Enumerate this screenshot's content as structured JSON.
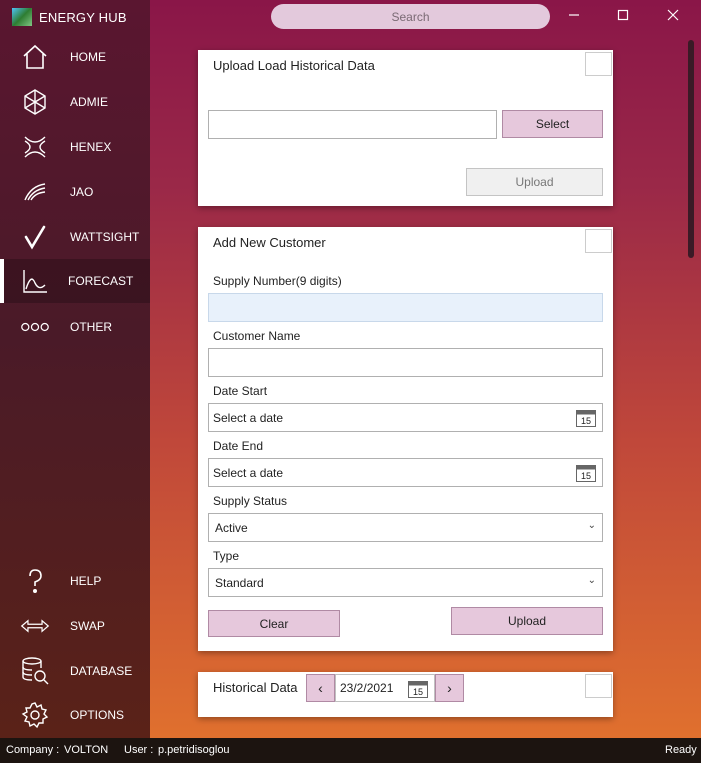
{
  "app": {
    "title": "ENERGY HUB"
  },
  "sidebar": {
    "items": [
      {
        "label": "HOME",
        "icon": "home-icon"
      },
      {
        "label": "ADMIE",
        "icon": "admie-logo-icon"
      },
      {
        "label": "HENEX",
        "icon": "henex-logo-icon"
      },
      {
        "label": "JAO",
        "icon": "jao-logo-icon"
      },
      {
        "label": "WATTSIGHT",
        "icon": "wattsight-logo-icon"
      },
      {
        "label": "FORECAST",
        "icon": "chart-icon",
        "active": true
      },
      {
        "label": "OTHER",
        "icon": "dots-icon"
      }
    ],
    "bottom_items": [
      {
        "label": "HELP",
        "icon": "question-icon"
      },
      {
        "label": "SWAP",
        "icon": "swap-arrows-icon"
      },
      {
        "label": "DATABASE",
        "icon": "database-search-icon"
      },
      {
        "label": "OPTIONS",
        "icon": "gear-icon"
      }
    ]
  },
  "search": {
    "placeholder": "Search"
  },
  "upload_historical": {
    "title": "Upload Load Historical Data",
    "file_value": "",
    "select_label": "Select",
    "upload_label": "Upload"
  },
  "add_customer": {
    "title": "Add New Customer",
    "supply_number_label": "Supply Number(9 digits)",
    "supply_number_value": "",
    "customer_name_label": "Customer Name",
    "customer_name_value": "",
    "date_start_label": "Date Start",
    "date_start_placeholder": "Select a date",
    "date_end_label": "Date End",
    "date_end_placeholder": "Select a date",
    "supply_status_label": "Supply Status",
    "supply_status_value": "Active",
    "type_label": "Type",
    "type_value": "Standard",
    "clear_label": "Clear",
    "upload_label": "Upload",
    "calendar_day": "15"
  },
  "historical_data": {
    "title": "Historical Data",
    "date_value": "23/2/2021",
    "prev_glyph": "‹",
    "next_glyph": "›",
    "calendar_day": "15"
  },
  "statusbar": {
    "company_label": "Company :",
    "company_value": "VOLTON",
    "user_label": "User :",
    "user_value": "p.petridisoglou",
    "status": "Ready"
  },
  "colors": {
    "accent_button": "#e6c8dc",
    "sidebar_top": "#5a1630",
    "main_top": "#8a1648",
    "main_bottom": "#e0702e"
  }
}
